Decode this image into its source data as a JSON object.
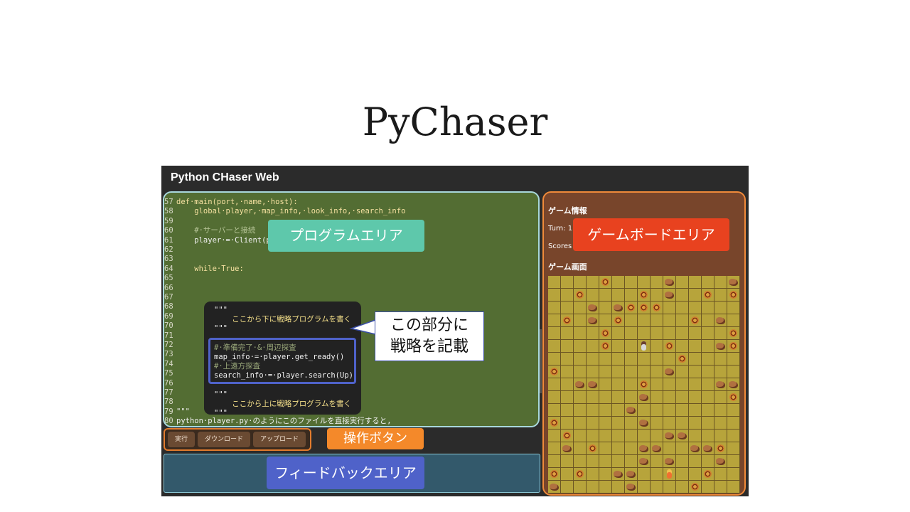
{
  "slide": {
    "title": "PyChaser"
  },
  "app": {
    "title": "Python CHaser Web"
  },
  "code": {
    "lines": [
      {
        "n": "57",
        "text": "def·main(port,·name,·host):"
      },
      {
        "n": "58",
        "text": "    global·player,·map_info,·look_info,·search_info"
      },
      {
        "n": "59",
        "text": ""
      },
      {
        "n": "60",
        "text": "    #·サーバーと接続"
      },
      {
        "n": "61",
        "text": "    player·=·Client(p"
      },
      {
        "n": "62",
        "text": ""
      },
      {
        "n": "63",
        "text": ""
      },
      {
        "n": "64",
        "text": "    while·True:"
      },
      {
        "n": "65",
        "text": ""
      },
      {
        "n": "66",
        "text": ""
      },
      {
        "n": "67",
        "text": ""
      },
      {
        "n": "68",
        "text": ""
      },
      {
        "n": "69",
        "text": ""
      },
      {
        "n": "70",
        "text": ""
      },
      {
        "n": "71",
        "text": ""
      },
      {
        "n": "72",
        "text": ""
      },
      {
        "n": "73",
        "text": ""
      },
      {
        "n": "74",
        "text": ""
      },
      {
        "n": "75",
        "text": ""
      },
      {
        "n": "76",
        "text": ""
      },
      {
        "n": "77",
        "text": ""
      },
      {
        "n": "78",
        "text": ""
      },
      {
        "n": "79",
        "text": "\"\"\""
      },
      {
        "n": "80",
        "text": "python·player.py·のようにこのファイルを直接実行すると,"
      }
    ],
    "snippet": [
      "\"\"\"",
      "    ここから下に戦略プログラムを書く",
      "\"\"\"",
      "",
      "#·準備完了·&·周辺探査",
      "map_info·=·player.get_ready()",
      "#·上遠方探査",
      "search_info·=·player.search(Up)",
      "",
      "\"\"\"",
      "    ここから上に戦略プログラムを書く",
      "\"\"\""
    ]
  },
  "labels": {
    "program_area": "プログラムエリア",
    "game_board_area": "ゲームボードエリア",
    "operation_buttons": "操作ボタン",
    "feedback_area": "フィードバックエリア",
    "callout_line1": "この部分に",
    "callout_line2": "戦略を記載"
  },
  "buttons": {
    "run": "実行",
    "download": "ダウンロード",
    "upload": "アップロード"
  },
  "game": {
    "info_heading": "ゲーム情報",
    "turn": "Turn: 1",
    "scores": "Scores",
    "screen_heading": "ゲーム画面",
    "legend": {
      "b": "block",
      "r": "rock",
      "p": "player",
      "e": "enemy",
      ".": "floor"
    },
    "board": [
      "....b....r....r",
      "..b....b.r..b.b",
      "...r.rbbb......",
      ".b.r.b.....b.r.",
      "....b.........b",
      "....b..p.b...rb",
      "..........b....",
      "b........r.....",
      "..rr...b.....rr",
      ".......r......b",
      "......r........",
      "b......r.......",
      ".b.......rr....",
      ".r.b...rr..rrb.",
      ".......r.r...r.",
      "b.b..rr..e..b..",
      "r.....r....b..."
    ]
  }
}
